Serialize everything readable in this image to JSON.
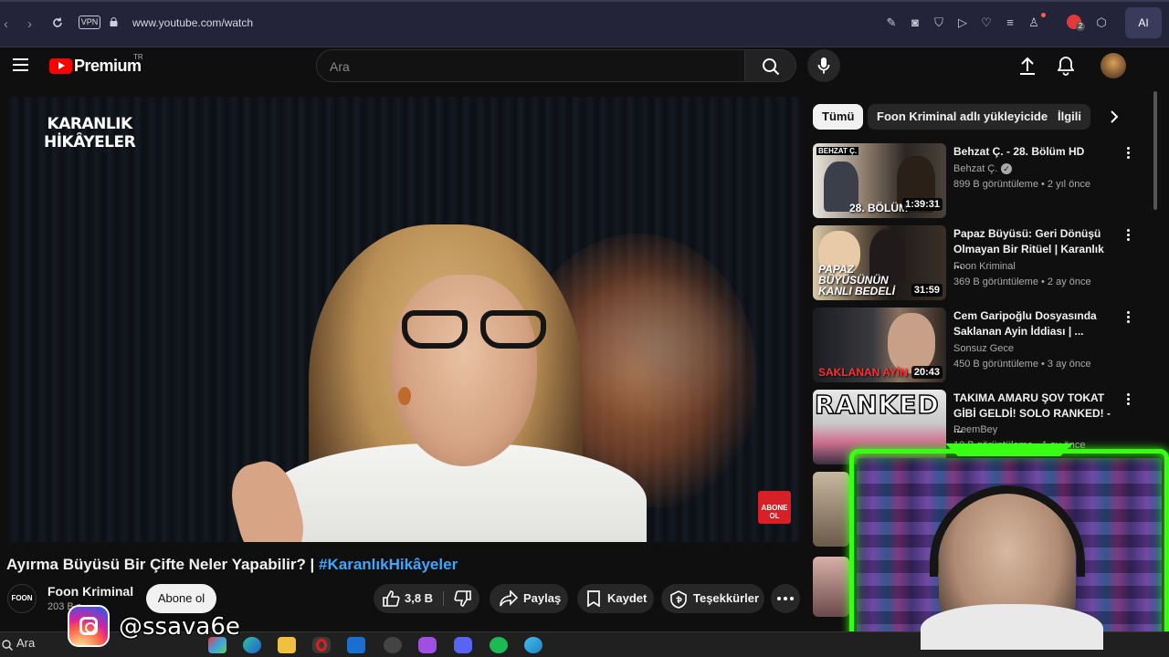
{
  "browser": {
    "vpn_label": "VPN",
    "url": "www.youtube.com/watch",
    "ai_label": "AI",
    "notification_count": "2"
  },
  "youtube": {
    "logo_text": "Premium",
    "country_code": "TR",
    "search_placeholder": "Ara"
  },
  "video": {
    "watermark_line1": "KARANLIK",
    "watermark_line2": "HİKÂYELER",
    "subscribe_badge": "ABONE OL",
    "title": "Ayırma Büyüsü Bir Çifte Neler Yapabilir? | ",
    "hashtag": "#KaranlıkHikâyeler"
  },
  "channel": {
    "avatar_text": "FOON",
    "name": "Foon Kriminal",
    "subscribers": "203 B a",
    "subscribe_label": "Abone ol"
  },
  "actions": {
    "likes": "3,8 B",
    "share": "Paylaş",
    "save": "Kaydet",
    "thanks": "Teşekkürler"
  },
  "chips": [
    "Tümü",
    "Foon Kriminal adlı yükleyiciden",
    "İlgili"
  ],
  "recommendations": [
    {
      "title": "Behzat Ç. - 28. Bölüm HD",
      "channel": "Behzat Ç.",
      "verified": true,
      "meta": "899 B görüntüleme • 2 yıl önce",
      "duration": "1:39:31",
      "thumb_caption": "28. BÖLÜM",
      "thumb_tag": "BEHZAT Ç."
    },
    {
      "title": "Papaz Büyüsü: Geri Dönüşü Olmayan Bir Ritüel | Karanlık ...",
      "channel": "Foon Kriminal",
      "meta": "369 B görüntüleme • 2 ay önce",
      "duration": "31:59",
      "thumb_caption": "PAPAZ BÜYÜSÜNÜN KANLI BEDELİ"
    },
    {
      "title": "Cem Garipoğlu Dosyasında Saklanan Ayin İddiası | ...",
      "channel": "Sonsuz Gece",
      "meta": "450 B görüntüleme • 3 ay önce",
      "duration": "20:43",
      "thumb_caption": "SAKLANAN AYİN"
    },
    {
      "title": "TAKIMA AMARU ŞOV TOKAT GİBİ GELDİ! SOLO RANKED! - ...",
      "channel": "ReemBey",
      "meta": "10 B görüntüleme • 1 ay önce",
      "thumb_caption": "RANKED"
    }
  ],
  "overlay": {
    "instagram_handle": "@ssava6e"
  },
  "taskbar": {
    "search_label": "Ara"
  }
}
